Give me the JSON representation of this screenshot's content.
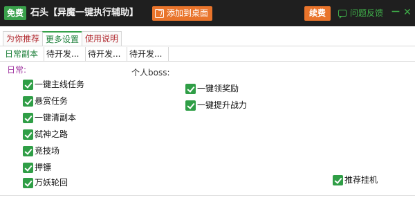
{
  "titlebar": {
    "free_badge": "免费",
    "title": "石头【异魔一键执行辅助】",
    "add_desktop": "添加到桌面",
    "renew": "续费",
    "feedback": "问题反馈",
    "minimize": "－",
    "close": "✕"
  },
  "tabs": [
    {
      "label": "为你推荐",
      "active": false
    },
    {
      "label": "更多设置",
      "active": true
    },
    {
      "label": "使用说明",
      "active": false
    }
  ],
  "subtabs": [
    {
      "label": "日常副本",
      "active": true
    },
    {
      "label": "待开发...",
      "active": false
    },
    {
      "label": "待开发...",
      "active": false
    },
    {
      "label": "待开发...",
      "active": false
    }
  ],
  "daily": {
    "label": "日常:",
    "items": [
      {
        "label": "一键主线任务",
        "checked": true
      },
      {
        "label": "悬赏任务",
        "checked": true
      },
      {
        "label": "一键清副本",
        "checked": true
      },
      {
        "label": "弑神之路",
        "checked": true
      },
      {
        "label": "竞技场",
        "checked": true
      },
      {
        "label": "押镖",
        "checked": true
      },
      {
        "label": "万妖轮回",
        "checked": true
      }
    ]
  },
  "boss": {
    "label": "个人boss:",
    "items": [
      {
        "label": "一键领奖励",
        "checked": true
      },
      {
        "label": "一键提升战力",
        "checked": true
      }
    ]
  },
  "recommend_hangup": {
    "label": "推荐挂机",
    "checked": true
  },
  "colors": {
    "titlebar_bg": "#1f1f1f",
    "accent_green": "#2f9e46",
    "accent_orange": "#e9742b",
    "tab_red": "#b1292f"
  }
}
